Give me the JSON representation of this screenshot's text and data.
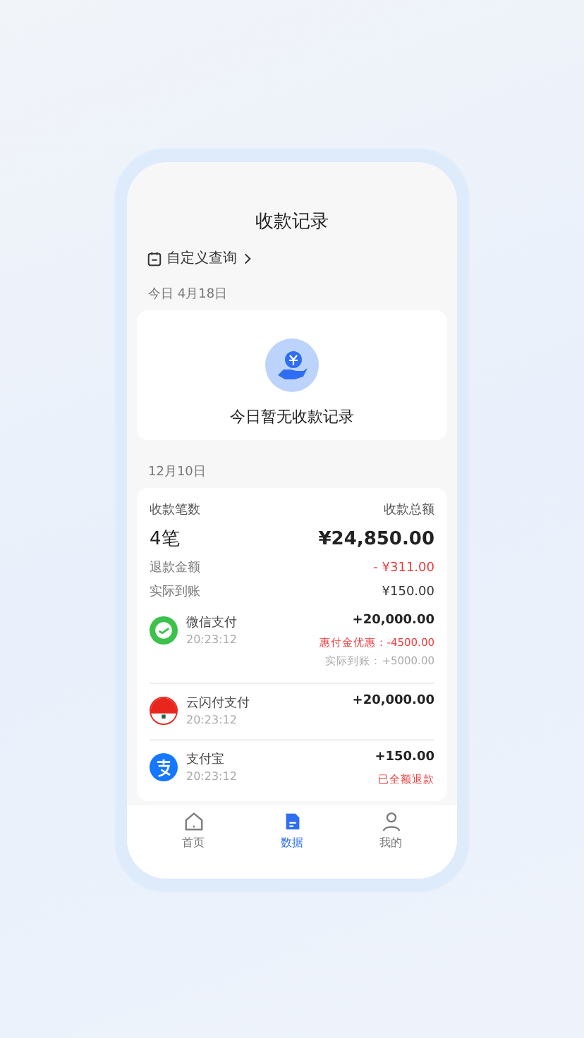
{
  "header": {
    "title": "收款记录"
  },
  "filter": {
    "label": "自定义查询"
  },
  "today": {
    "date_label": "今日 4月18日",
    "empty_text": "今日暂无收款记录"
  },
  "day": {
    "date_label": "12月10日",
    "summary": {
      "count_label": "收款笔数",
      "count": "4笔",
      "total_label": "收款总额",
      "total": "¥24,850.00",
      "refund_label": "退款金额",
      "refund": "- ¥311.00",
      "net_label": "实际到账",
      "net": "¥150.00"
    },
    "payments": [
      {
        "kind": "wechat",
        "name": "微信支付",
        "time": "20:23:12",
        "amount": "+20,000.00",
        "notes": [
          {
            "kind": "discount",
            "text": "惠付金优惠：-4500.00"
          },
          {
            "kind": "net",
            "text": "实际到账：+5000.00"
          }
        ]
      },
      {
        "kind": "unionpay",
        "name": "云闪付支付",
        "time": "20:23:12",
        "amount": "+20,000.00"
      },
      {
        "kind": "alipay",
        "name": "支付宝",
        "time": "20:23:12",
        "amount": "+150.00",
        "notes": [
          {
            "kind": "refund",
            "text": "已全额退款"
          }
        ]
      }
    ]
  },
  "tabs": [
    {
      "kind": "home",
      "label": "首页",
      "selected": false
    },
    {
      "kind": "data",
      "label": "数据",
      "selected": true
    },
    {
      "kind": "profile",
      "label": "我的",
      "selected": false
    }
  ]
}
